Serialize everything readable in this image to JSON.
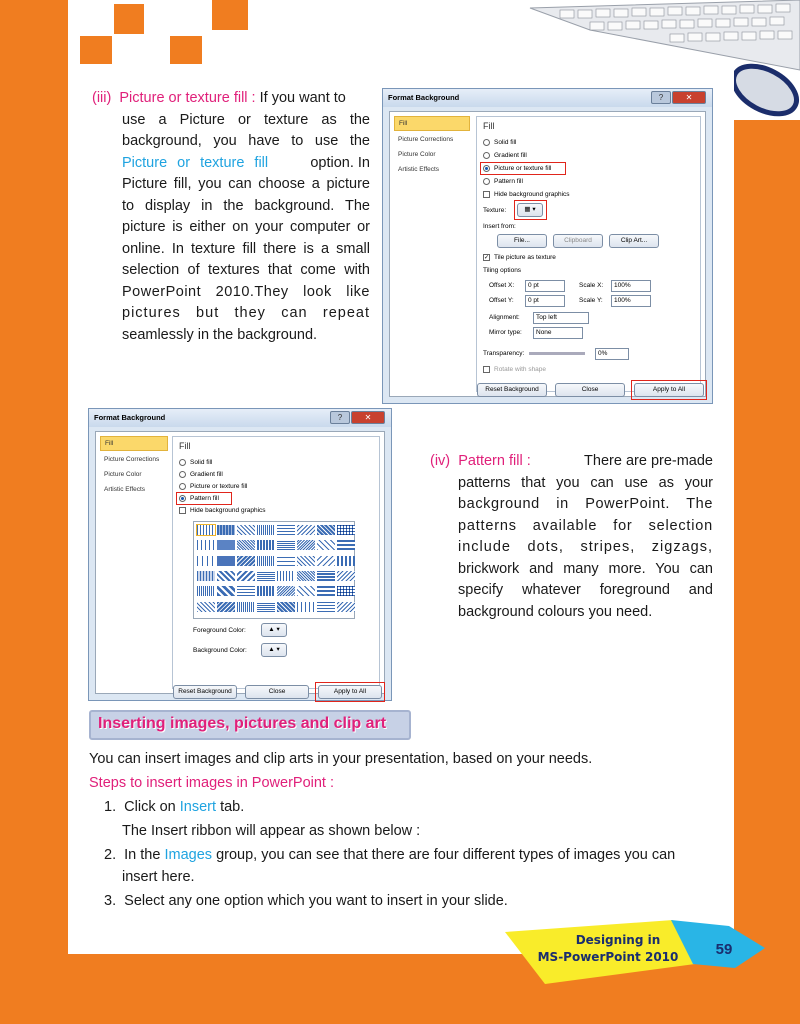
{
  "colors": {
    "orange": "#f07d20",
    "blue": "#1fa3e0",
    "pink": "#e0207a",
    "yellow": "#f9ec2a",
    "cyan": "#29b5e6"
  },
  "para3": {
    "num": "(iii)",
    "head": "Picture or texture fill :",
    "l1": "If you want to",
    "l2": "use a Picture or texture as the",
    "l3": "background, you have to use the",
    "l4a": "Picture or texture fill",
    "l4b": "option. In",
    "l5": "Picture fill, you can choose a picture",
    "l6": "to display in the background. The",
    "l7": "picture is either on your computer or",
    "l8": "online. In texture fill there is a small",
    "l9": "selection of textures that come with",
    "l10": "PowerPoint 2010.They look like",
    "l11": "pictures but they can repeat",
    "l12": "seamlessly in the background."
  },
  "dialog1": {
    "title": "Format Background",
    "nav": [
      "Fill",
      "Picture Corrections",
      "Picture Color",
      "Artistic Effects"
    ],
    "heading": "Fill",
    "options": [
      "Solid fill",
      "Gradient fill",
      "Picture or texture fill",
      "Pattern fill"
    ],
    "hide": "Hide background graphics",
    "texture": "Texture:",
    "insert_from": "Insert from:",
    "file": "File...",
    "clipboard": "Clipboard",
    "clipart": "Clip Art...",
    "tile": "Tile picture as texture",
    "tiling": "Tiling options",
    "offx": "Offset X:",
    "offx_v": "0 pt",
    "scalex": "Scale X:",
    "scalex_v": "100%",
    "offy": "Offset Y:",
    "offy_v": "0 pt",
    "scaley": "Scale Y:",
    "scaley_v": "100%",
    "align": "Alignment:",
    "align_v": "Top left",
    "mirror": "Mirror type:",
    "mirror_v": "None",
    "transp": "Transparency:",
    "transp_v": "0%",
    "rotate": "Rotate with shape",
    "reset": "Reset Background",
    "close": "Close",
    "apply": "Apply to All"
  },
  "dialog2": {
    "title": "Format Background",
    "nav": [
      "Fill",
      "Picture Corrections",
      "Picture Color",
      "Artistic Effects"
    ],
    "heading": "Fill",
    "options": [
      "Solid fill",
      "Gradient fill",
      "Picture or texture fill",
      "Pattern fill"
    ],
    "hide": "Hide background graphics",
    "fg": "Foreground Color:",
    "bg": "Background Color:",
    "reset": "Reset Background",
    "close": "Close",
    "apply": "Apply to All"
  },
  "para4": {
    "num": "(iv)",
    "head": "Pattern fill :",
    "l1": "There are pre-made",
    "l2": "patterns that you can use as your",
    "l3": "background in PowerPoint. The",
    "l4": "patterns available for selection",
    "l5": "include dots, stripes, zigzags,",
    "l6": "brickwork and many more. You can",
    "l7": "specify whatever foreground and",
    "l8": "background colours you need."
  },
  "section": {
    "title": "Inserting images, pictures and clip art",
    "intro": "You can insert images and clip arts in your presentation, based on your needs.",
    "steps_head": "Steps to insert images in PowerPoint :",
    "s1_num": "1.",
    "s1a": "Click on",
    "s1b": "Insert",
    "s1c": "tab.",
    "s1_note": "The Insert ribbon will appear as shown below :",
    "s2_num": "2.",
    "s2a": "In the",
    "s2b": "Images",
    "s2c": "group, you can see that there are four different types of images you can",
    "s2d": "insert here.",
    "s3_num": "3.",
    "s3": "Select any one option which you want to insert in your slide."
  },
  "footer": {
    "l1": "Designing in",
    "l2": "MS-PowerPoint 2010",
    "page": "59"
  }
}
